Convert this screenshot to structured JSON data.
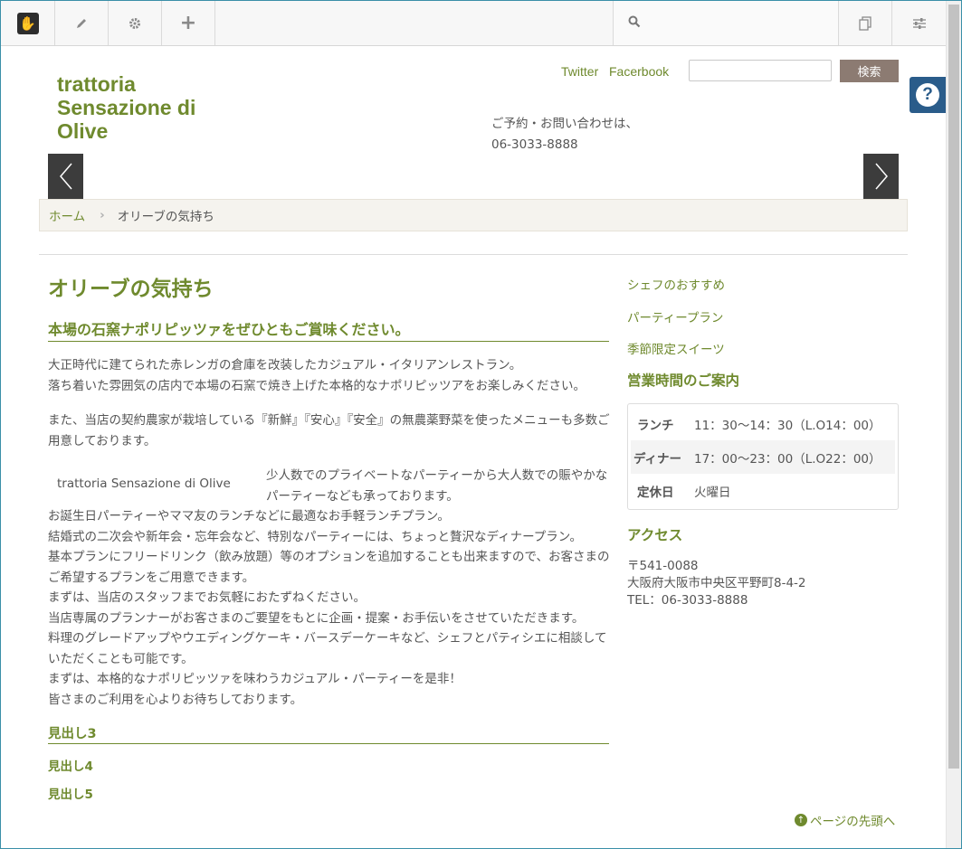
{
  "toolbar": {
    "logo_glyph": "✋",
    "search_placeholder": ""
  },
  "header": {
    "site_title": "trattoria Sensazione di Olive",
    "twitter": "Twitter",
    "facebook": "Facerbook",
    "search_value": "",
    "search_button": "検索",
    "contact_line1": "ご予約・お問い合わせは、",
    "contact_line2": "06-3033-8888"
  },
  "breadcrumb": {
    "home": "ホーム",
    "current": "オリーブの気持ち"
  },
  "main": {
    "page_title": "オリーブの気持ち",
    "heading2": "本場の石窯ナポリピッツァをぜひともご賞味ください。",
    "p1": [
      "大正時代に建てられた赤レンガの倉庫を改装したカジュアル・イタリアンレストラン。",
      "落ち着いた雰囲気の店内で本場の石窯で焼き上げた本格的なナポリピッツアをお楽しみください。"
    ],
    "p2": "また、当店の契約農家が栽培している『新鮮』『安心』『安全』の無農薬野菜を使ったメニューも多数ご用意しております。",
    "image_caption": "trattoria Sensazione di Olive",
    "p3": "少人数でのプライベートなパーティーから大人数での賑やかなパーティーなども承っております。",
    "p4": [
      "お誕生日パーティーやママ友のランチなどに最適なお手軽ランチプラン。",
      "結婚式の二次会や新年会・忘年会など、特別なパーティーには、ちょっと贅沢なディナープラン。",
      "基本プランにフリードリンク（飲み放題）等のオプションを追加することも出来ますので、お客さまのご希望するプランをご用意できます。",
      "まずは、当店のスタッフまでお気軽におたずねください。",
      "当店専属のプランナーがお客さまのご要望をもとに企画・提案・お手伝いをさせていただきます。",
      "料理のグレードアップやウエディングケーキ・バースデーケーキなど、シェフとパティシエに相談していただくことも可能です。",
      "まずは、本格的なナポリピッツァを味わうカジュアル・パーティーを是非！",
      "皆さまのご利用を心よりお待ちしております。"
    ],
    "heading3": "見出し3",
    "heading4": "見出し4",
    "heading5": "見出し5"
  },
  "sidebar": {
    "links": [
      "シェフのおすすめ",
      "パーティープラン",
      "季節限定スイーツ"
    ],
    "hours_title": "営業時間のご案内",
    "hours": [
      {
        "label": "ランチ",
        "value": "11：30〜14：30（L.O14：00）"
      },
      {
        "label": "ディナー",
        "value": "17：00〜23：00（L.O22：00）"
      },
      {
        "label": "定休日",
        "value": "火曜日"
      }
    ],
    "access_title": "アクセス",
    "address": [
      "〒541-0088",
      "大阪府大阪市中央区平野町8-4-2",
      "TEL：06-3033-8888"
    ]
  },
  "footer": {
    "page_top": "ページの先頭へ"
  },
  "colors": {
    "accent": "#6f8a2e",
    "search_button": "#8c7b72",
    "help": "#2a5c8a"
  }
}
